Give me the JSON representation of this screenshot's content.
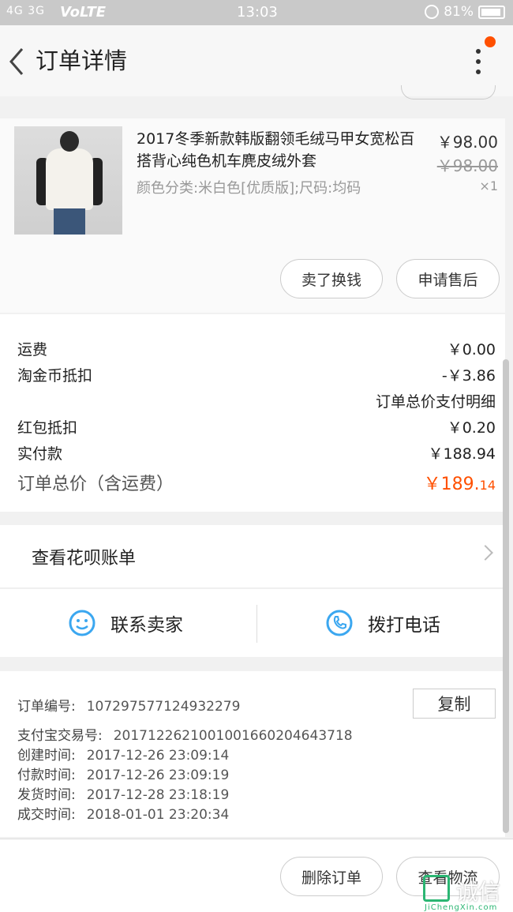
{
  "status_bar": {
    "signal": "4G 3G",
    "network": "VoLTE",
    "time": "13:03",
    "battery": "81%"
  },
  "header": {
    "title": "订单详情"
  },
  "product": {
    "name": "2017冬季新款韩版翻领毛绒马甲女宽松百搭背心纯色机车麂皮绒外套",
    "attributes": "颜色分类:米白色[优质版];尺码:均码",
    "price": "￥98.00",
    "original_price": "￥98.00",
    "quantity": "×1",
    "buttons": {
      "sell": "卖了换钱",
      "after_sale": "申请售后"
    }
  },
  "fees": {
    "shipping_label": "运费",
    "shipping_value": "￥0.00",
    "coin_label": "淘金币抵扣",
    "coin_value": "-￥3.86",
    "detail_link": "订单总价支付明细",
    "redpacket_label": "红包抵扣",
    "redpacket_value": "￥0.20",
    "paid_label": "实付款",
    "paid_value": "￥188.94",
    "total_label": "订单总价（含运费）",
    "total_value_main": "￥189.",
    "total_value_cents": "14"
  },
  "huabei": {
    "label": "查看花呗账单"
  },
  "contact": {
    "seller_label": "联系卖家",
    "call_label": "拨打电话"
  },
  "order_info": {
    "order_no_label": "订单编号:",
    "order_no": "107297577124932279",
    "copy_label": "复制",
    "alipay_label": "支付宝交易号:",
    "alipay_no": "2017122621001001660204643718",
    "created_label": "创建时间:",
    "created": "2017-12-26 23:09:14",
    "paid_label": "付款时间:",
    "paid": "2017-12-26 23:09:19",
    "shipped_label": "发货时间:",
    "shipped": "2017-12-28 23:18:19",
    "closed_label": "成交时间:",
    "closed": "2018-01-01 23:20:34"
  },
  "bottom_bar": {
    "delete_label": "删除订单",
    "logistics_label": "查看物流"
  },
  "watermark": {
    "text": "诚信",
    "url": "JiChengXin.com"
  },
  "colors": {
    "accent": "#ff5000",
    "icon_blue": "#3ba7f0"
  }
}
